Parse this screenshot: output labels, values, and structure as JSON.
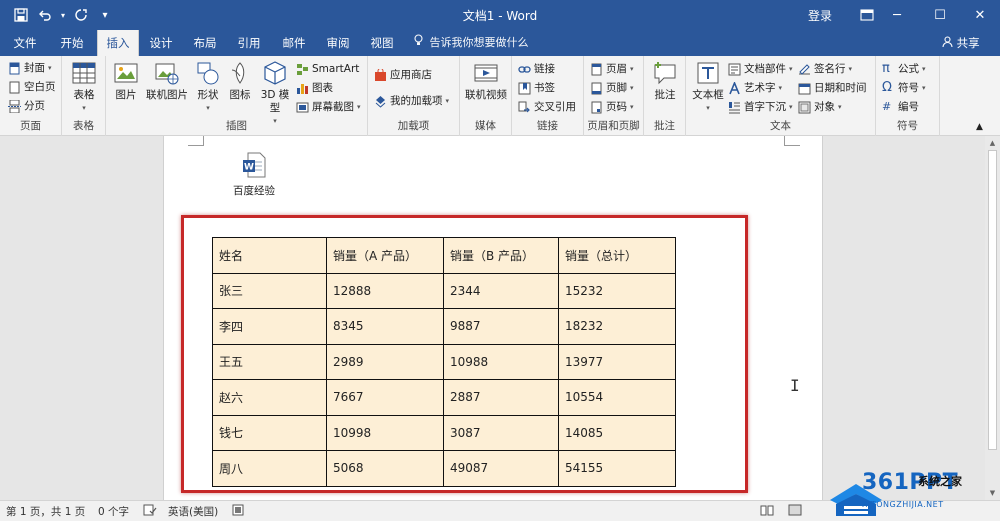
{
  "window": {
    "title": "文档1 - Word",
    "signin": "登录",
    "min_glyph": "─",
    "max_glyph": "☐",
    "close_glyph": "✕",
    "restore_glyph": "⊡"
  },
  "tabs": [
    {
      "label": "文件"
    },
    {
      "label": "开始"
    },
    {
      "label": "插入"
    },
    {
      "label": "设计"
    },
    {
      "label": "布局"
    },
    {
      "label": "引用"
    },
    {
      "label": "邮件"
    },
    {
      "label": "审阅"
    },
    {
      "label": "视图"
    }
  ],
  "tellme": "告诉我你想要做什么",
  "share": "共享",
  "ribbon": {
    "pages": {
      "label": "页面",
      "items": [
        "封面",
        "空白页",
        "分页"
      ]
    },
    "tables": {
      "label": "表格",
      "button": "表格"
    },
    "illustrations": {
      "label": "插图",
      "buttons": [
        "图片",
        "联机图片",
        "形状",
        "图标",
        "3D 模型"
      ],
      "side": [
        "SmartArt",
        "图表",
        "屏幕截图"
      ]
    },
    "addins": {
      "label": "加载项",
      "items": [
        "应用商店",
        "我的加载项"
      ]
    },
    "media": {
      "label": "媒体",
      "button": "联机视频"
    },
    "links": {
      "label": "链接",
      "items": [
        "链接",
        "书签",
        "交叉引用"
      ]
    },
    "header_footer": {
      "label": "页眉和页脚",
      "items": [
        "页眉",
        "页脚",
        "页码"
      ]
    },
    "comments": {
      "label": "批注",
      "button": "批注"
    },
    "text": {
      "label": "文本",
      "button": "文本框",
      "col1": [
        "文档部件",
        "艺术字",
        "首字下沉"
      ],
      "col2": [
        "签名行",
        "日期和时间",
        "对象"
      ]
    },
    "symbols": {
      "label": "符号",
      "items": [
        "公式",
        "符号",
        "编号"
      ]
    }
  },
  "document": {
    "embedded_object_label": "百度经验",
    "table": {
      "header": [
        "姓名",
        "销量（A 产品）",
        "销量（B 产品）",
        "销量（总计）"
      ],
      "rows": [
        [
          "张三",
          "12888",
          "2344",
          "15232"
        ],
        [
          "李四",
          "8345",
          "9887",
          "18232"
        ],
        [
          "王五",
          "2989",
          "10988",
          "13977"
        ],
        [
          "赵六",
          "7667",
          "2887",
          "10554"
        ],
        [
          "钱七",
          "10998",
          "3087",
          "14085"
        ],
        [
          "周八",
          "5068",
          "49087",
          "54155"
        ]
      ]
    }
  },
  "status": {
    "page": "第 1 页，共 1 页",
    "words": "0 个字",
    "language": "英语(美国)"
  },
  "watermark": {
    "brand": "361PPT",
    "cn": "系统之家",
    "sub": "XITONGZHIJIA.NET"
  },
  "colors": {
    "title_bar": "#2b579a",
    "table_fill": "#fdefd6",
    "highlight_box": "#c62828"
  }
}
